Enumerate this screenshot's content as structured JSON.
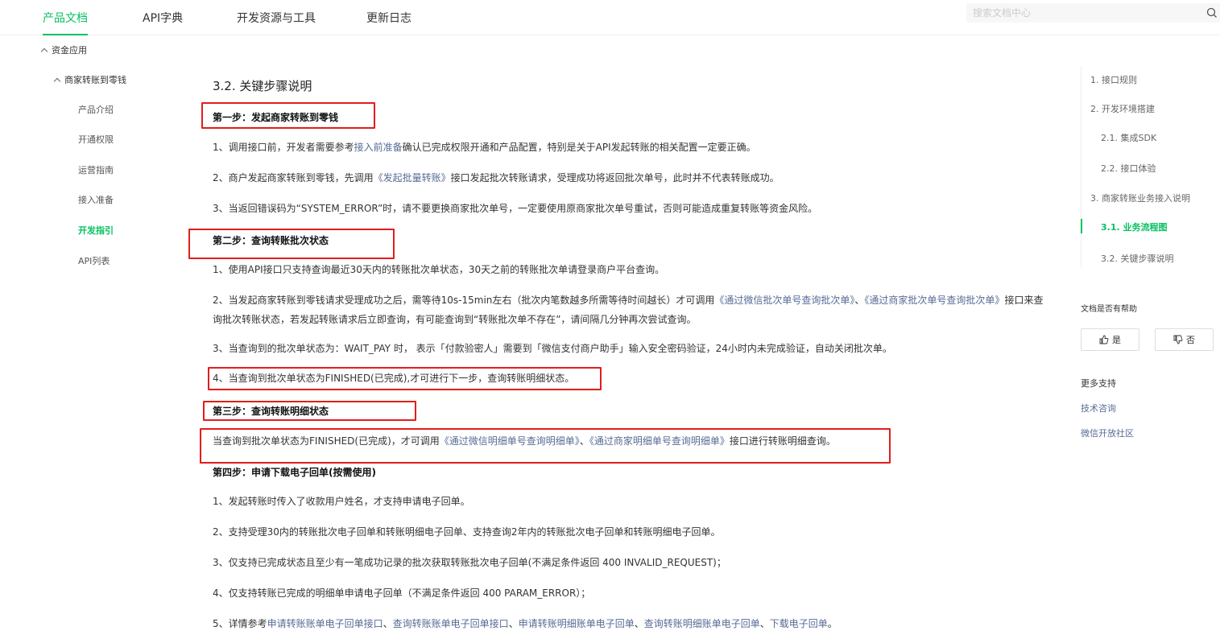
{
  "nav": {
    "items": [
      "产品文档",
      "API字典",
      "开发资源与工具",
      "更新日志"
    ],
    "active": "产品文档"
  },
  "search": {
    "placeholder": "搜索文档中心"
  },
  "sidebar": {
    "group1": "资金应用",
    "group2": "商家转账到零钱",
    "items": [
      "产品介绍",
      "开通权限",
      "运营指南",
      "接入准备",
      "开发指引",
      "API列表"
    ],
    "active": "开发指引"
  },
  "content": {
    "section_title": "3.2. 关键步骤说明",
    "step1": {
      "title": "第一步：发起商家转账到零钱",
      "p1": {
        "pre": "1、调用接口前，开发者需要参考",
        "link": "接入前准备",
        "post": "确认已完成权限开通和产品配置，特别是关于API发起转账的相关配置一定要正确。"
      },
      "p2": {
        "pre": "2、商户发起商家转账到零钱，先调用",
        "link": "《发起批量转账》",
        "post": "接口发起批次转账请求，受理成功将返回批次单号，此时并不代表转账成功。"
      },
      "p3": "3、当返回错误码为“SYSTEM_ERROR”时，请不要更换商家批次单号，一定要使用原商家批次单号重试，否则可能造成重复转账等资金风险。"
    },
    "step2": {
      "title": "第二步：查询转账批次状态",
      "p1": "1、使用API接口只支持查询最近30天内的转账批次单状态，30天之前的转账批次单请登录商户平台查询。",
      "p2": {
        "pre": "2、当发起商家转账到零钱请求受理成功之后，需等待10s-15min左右（批次内笔数越多所需等待时间越长）才可调用",
        "link1": "《通过微信批次单号查询批次单》",
        "mid": "、",
        "link2": "《通过商家批次单号查询批次单》",
        "post": "接口来查询批次转账状态，若发起转账请求后立即查询，有可能查询到“转账批次单不存在”，请间隔几分钟再次尝试查询。"
      },
      "p3": "3、当查询到的批次单状态为：WAIT_PAY 时， 表示「付款验密人」需要到「微信支付商户助手」输入安全密码验证，24小时内未完成验证，自动关闭批次单。",
      "p4": "4、当查询到批次单状态为FINISHED(已完成),才可进行下一步，查询转账明细状态。"
    },
    "step3": {
      "title": "第三步：查询转账明细状态",
      "p1": {
        "pre": "当查询到批次单状态为FINISHED(已完成)，才可调用",
        "link1": "《通过微信明细单号查询明细单》",
        "mid": "、",
        "link2": "《通过商家明细单号查询明细单》",
        "post": "接口进行转账明细查询。"
      }
    },
    "step4": {
      "title": "第四步：申请下载电子回单(按需使用)",
      "p1": "1、发起转账时传入了收款用户姓名，才支持申请电子回单。",
      "p2": "2、支持受理30内的转账批次电子回单和转账明细电子回单、支持查询2年内的转账批次电子回单和转账明细电子回单。",
      "p3": "3、仅支持已完成状态且至少有一笔成功记录的批次获取转账批次电子回单(不满足条件返回 400 INVALID_REQUEST)；",
      "p4": "4、仅支持转账已完成的明细单申请电子回单（不满足条件返回 400 PARAM_ERROR）；",
      "p5": {
        "pre": "5、详情参考",
        "links": [
          "申请转账账单电子回单接口",
          "查询转账账单电子回单接口",
          "申请转账明细账单电子回单",
          "查询转账明细账单电子回单",
          "下载电子回单"
        ],
        "sep": "、",
        "post": "。"
      }
    }
  },
  "toc": {
    "items": [
      "1. 接口规则",
      "2. 开发环境搭建",
      "2.1. 集成SDK",
      "2.2. 接口体验",
      "3. 商家转账业务接入说明",
      "3.1. 业务流程图",
      "3.2. 关键步骤说明"
    ],
    "active": "3.1. 业务流程图"
  },
  "feedback": {
    "question": "文档是否有帮助",
    "yes": "是",
    "no": "否"
  },
  "more_support": {
    "title": "更多支持",
    "links": [
      "技术咨询",
      "微信开放社区"
    ]
  },
  "colors": {
    "accent": "#07c160",
    "link": "#576b95",
    "highlight_box": "#e21d1d"
  }
}
